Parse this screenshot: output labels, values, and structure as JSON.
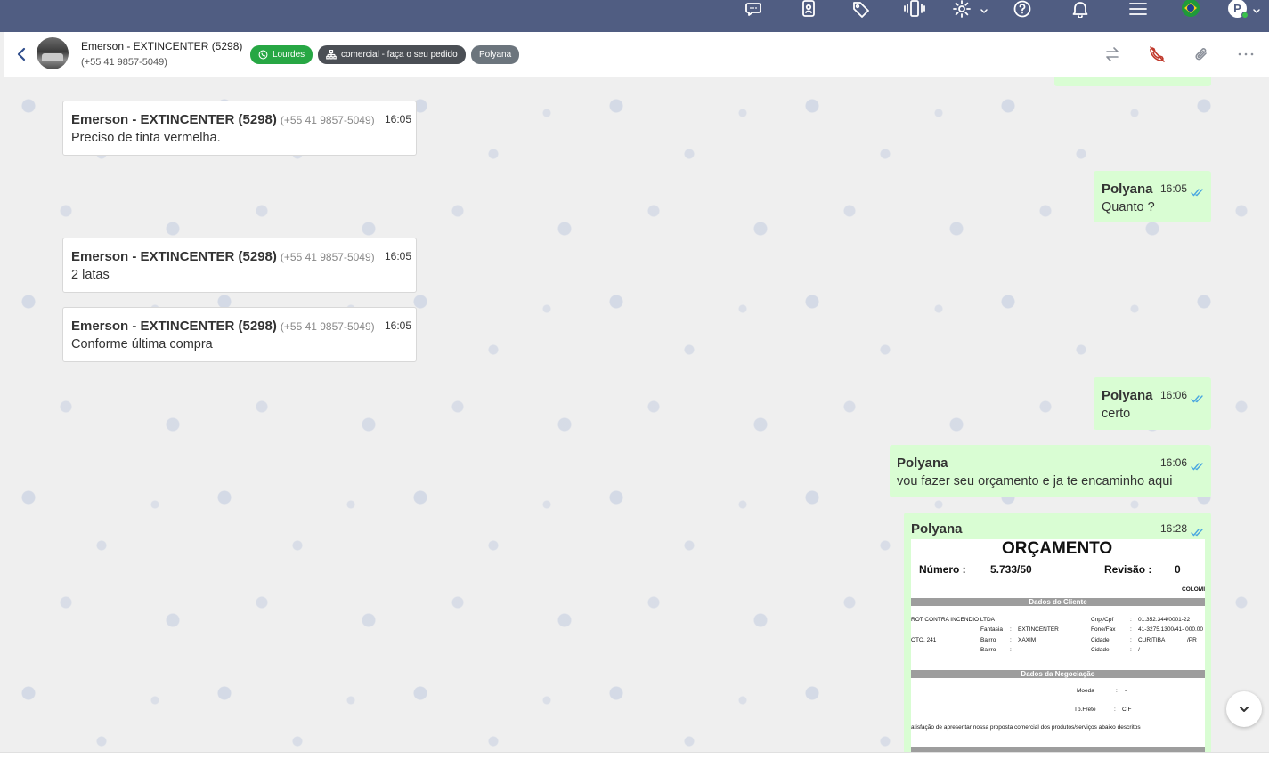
{
  "colors": {
    "topbar": "#505d82",
    "incoming_bubble": "#ffffff",
    "outgoing_bubble": "#d9fdd3",
    "read_check": "#4aa7e0",
    "tag_green": "#27a744",
    "tag_dark": "#4b4f55",
    "tag_gray": "#6c757d",
    "hangup_red": "#c0392b"
  },
  "topbar": {
    "icons": [
      "chat-bubbles-icon",
      "contacts-book-icon",
      "tag-icon",
      "phone-vibrate-icon",
      "gear-icon",
      "help-icon",
      "bell-icon",
      "hamburger-menu-icon",
      "brazil-flag-icon"
    ],
    "user_initial": "P"
  },
  "header": {
    "contact_name": "Emerson - EXTINCENTER (5298)",
    "contact_phone": "(+55 41 9857-5049)",
    "tags": [
      "Lourdes",
      "comercial - faça o seu pedido",
      "Polyana"
    ],
    "actions": [
      "transfer-icon",
      "hangup-icon",
      "paperclip-icon",
      "more-options-icon"
    ]
  },
  "messages": [
    {
      "direction": "in",
      "sender": "Emerson - EXTINCENTER (5298)",
      "phone": "(+55 41 9857-5049)",
      "time": "16:05",
      "text": "Preciso de tinta vermelha."
    },
    {
      "direction": "out",
      "sender": "Polyana",
      "time": "16:05",
      "text": "Quanto ?"
    },
    {
      "direction": "in",
      "sender": "Emerson - EXTINCENTER (5298)",
      "phone": "(+55 41 9857-5049)",
      "time": "16:05",
      "text": "2 latas"
    },
    {
      "direction": "in",
      "sender": "Emerson - EXTINCENTER (5298)",
      "phone": "(+55 41 9857-5049)",
      "time": "16:05",
      "text": "Conforme última compra"
    },
    {
      "direction": "out",
      "sender": "Polyana",
      "time": "16:06",
      "text": "certo"
    },
    {
      "direction": "out",
      "sender": "Polyana",
      "time": "16:06",
      "text": "vou fazer seu orçamento e ja te encaminho aqui"
    },
    {
      "direction": "out",
      "sender": "Polyana",
      "time": "16:28",
      "text": ""
    }
  ],
  "quote_doc": {
    "title": "ORÇAMENTO",
    "numero_label": "Número :",
    "numero_value": "5.733/50",
    "revisao_label": "Revisão :",
    "revisao_value": "0",
    "corner_text": "COLOMI",
    "section_client": "Dados do Cliente",
    "client_name": "ROT CONTRA INCENDIO LTDA",
    "fantasia_label": "Fantasia",
    "fantasia_value": "EXTINCENTER",
    "address": "OTO, 241",
    "bairro_label": "Bairro",
    "bairro_value": "XAXIM",
    "bairro2_label": "Bairro",
    "cnpj_label": "Cnpj/Cpf",
    "cnpj_value": "01.352.344/0001-22",
    "fone_label": "Fone/Fax",
    "fone_value": "41-3275.1300/41- 000.00",
    "cidade_label": "Cidade",
    "cidade_value": "CURITIBA",
    "uf_value": "/PR",
    "cidade2_label": "Cidade",
    "cidade2_value": "/",
    "section_negotiation": "Dados da Negociação",
    "moeda_label": "Moeda",
    "moeda_value": "-",
    "frete_label": "Tp.Frete",
    "frete_value": "CIF",
    "intro_text": "atisfação de apresentar nossa proposta comercial dos produtos/serviços abaixo descritos",
    "colon": ":"
  }
}
